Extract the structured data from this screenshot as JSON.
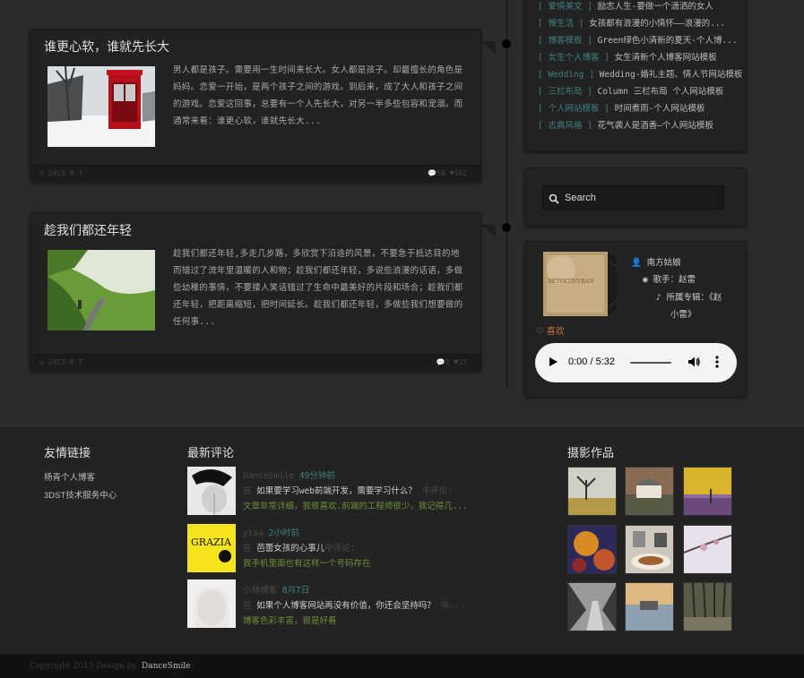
{
  "sidebar_list": [
    {
      "cat": "[ 爱情美文 ]",
      "title": "励志人生-要做一个潇洒的女人"
    },
    {
      "cat": "[ 慢生活 ]",
      "title": "女孩都有浪漫的小情怀——浪漫的..."
    },
    {
      "cat": "[ 博客模板 ]",
      "title": "Green绿色小清新的夏天-个人博..."
    },
    {
      "cat": "[ 女生个人博客 ]",
      "title": "女生清新个人博客网站模板"
    },
    {
      "cat": "[ Wedding ]",
      "title": "Wedding-婚礼主题、情人节网站模板"
    },
    {
      "cat": "[ 三栏布局 ]",
      "title": "Column 三栏布局 个人网站模板"
    },
    {
      "cat": "[ 个人网站模板 ]",
      "title": "时间煮雨-个人网站模板"
    },
    {
      "cat": "[ 古典风格 ]",
      "title": "花气袭人是酒香—个人网站模板"
    }
  ],
  "posts": [
    {
      "title": "谁更心软，谁就先长大",
      "text": "男人都是孩子。需要用一生时间来长大。女人都是孩子。却最擅长的角色是妈妈。恋爱一开始，是两个孩子之间的游戏。到后来，成了大人和孩子之间的游戏。恋爱这回事，总要有一个人先长大，对另一半多些包容和宠溺。而通常来看：谁更心软，谁就先长大...",
      "date": "2013-8-7",
      "comments": "58",
      "likes": "102"
    },
    {
      "title": "趁我们都还年轻",
      "text": "趁我们都还年轻,多走几步路，多欣赏下沿途的风景，不要急于抵达目的地而错过了流年里温暖的人和物；趁我们都还年轻，多说些浪漫的话语，多做些幼稚的事情，不要搂人笑话错过了生命中最美好的片段和场合；趁我们都还年轻，把距离缩短，把时间延长。趁我们都还年轻，多做些我们想要做的任何事...",
      "date": "2013-8-7",
      "comments": "2",
      "likes": "15"
    }
  ],
  "search": {
    "placeholder": "Search"
  },
  "music": {
    "cover_text": "DETEKTIVVRAN",
    "user": "南方姑娘",
    "singer": "歌手：赵雷",
    "album_a": "所属专辑：《赵",
    "album_b": "小雷》",
    "like": "喜欢",
    "time": "0:00 / 5:32"
  },
  "footer": {
    "links_title": "友情链接",
    "links": [
      "杨青个人博客",
      "3DST技术服务中心"
    ],
    "comments_title": "最新评论",
    "comments": [
      {
        "user": "DanceSmile",
        "time": "49分钟前",
        "pre": "在",
        "post": "如果要学习web前端开发，需要学习什么？",
        "tail": "中评论:",
        "body": "文章非常详细，我很喜欢.前端的工程师很少，我记得几..."
      },
      {
        "user": "yisa",
        "time": "2小时前",
        "pre": "在",
        "post": "芭蕾女孩的心事儿",
        "tail": "中评论:",
        "body": "我手机里面也有这样一个号码存在"
      },
      {
        "user": "小林博客",
        "time": "8月7日",
        "pre": "在",
        "post": "如果个人博客网站再没有价值，你还会坚持吗？",
        "tail": "中...",
        "body": "博客色彩丰富，很是好看"
      }
    ],
    "photos_title": "摄影作品"
  },
  "copyright": {
    "text": "Copyright 2013 Design by ",
    "author": "DanceSmile"
  },
  "colors": {
    "accent_teal": "#3e7f7f",
    "accent_green": "#6d8f37",
    "like_orange": "#c8773a",
    "bg": "#2b2b2b"
  }
}
